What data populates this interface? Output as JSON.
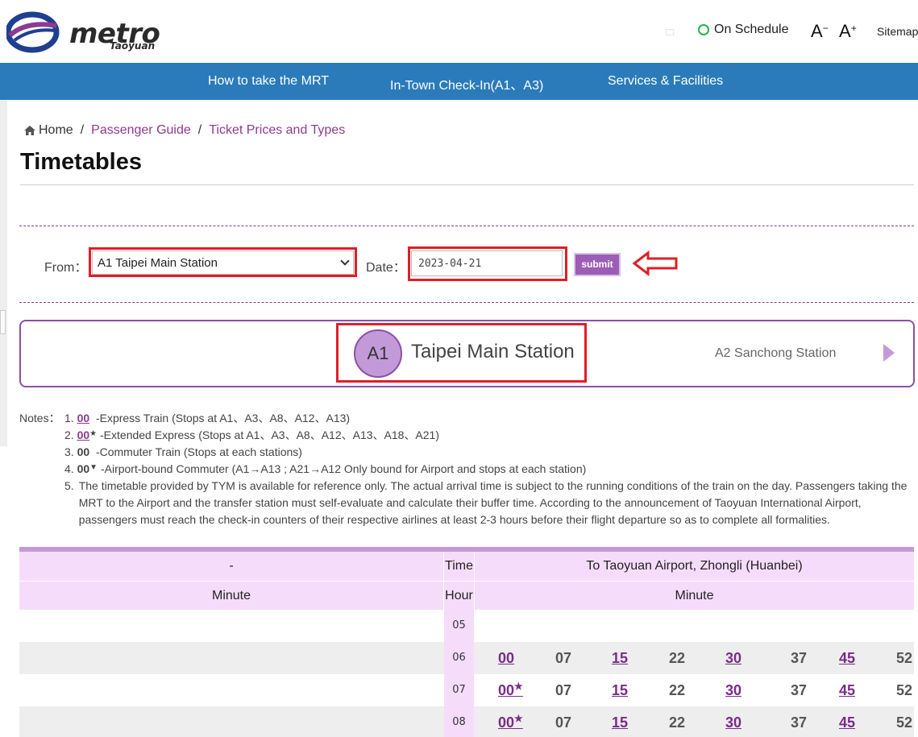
{
  "header": {
    "logo_text": "metro",
    "logo_sub": "Taoyuan",
    "status": "On Schedule",
    "font_decrease": "A",
    "font_decrease_sup": "−",
    "font_increase": "A",
    "font_increase_sup": "+",
    "sitemap": "Sitemap",
    "status_color": "#2ab04a"
  },
  "nav": {
    "items": [
      "How to take the MRT",
      "In-Town Check-In(A1、A3)",
      "Services & Facilities"
    ],
    "bg_color": "#2b7bba"
  },
  "breadcrumb": {
    "home": "Home",
    "sep": "/",
    "items": [
      "Passenger Guide",
      "Ticket Prices and Types"
    ]
  },
  "page_title": "Timetables",
  "form": {
    "from_label": "From：",
    "from_value": "A1 Taipei Main Station",
    "date_label": "Date：",
    "date_value": "2023-04-21",
    "submit_label": "submit"
  },
  "station": {
    "code": "A1",
    "name": "Taipei Main Station",
    "next": "A2 Sanchong Station"
  },
  "notes": {
    "label": "Notes：",
    "items": [
      {
        "num": "1.",
        "code": "00",
        "sup": "",
        "text": "-Express Train (Stops at A1、A3、A8、A12、A13)"
      },
      {
        "num": "2.",
        "code": "00",
        "sup": "★",
        "text": "-Extended Express (Stops at A1、A3、A8、A12、A13、A18、A21)"
      },
      {
        "num": "3.",
        "code": "00",
        "sup": "",
        "text": "-Commuter Train (Stops at each stations)"
      },
      {
        "num": "4.",
        "code": "00",
        "sup": "▼",
        "text": "-Airport-bound Commuter (A1→A13 ; A21→A12 Only bound for Airport and stops at each station)"
      },
      {
        "num": "5.",
        "code": "",
        "sup": "",
        "text": "The timetable provided by TYM is available for reference only. The actual arrival time is subject to the running conditions of the train on the day. Passengers taking the MRT to the Airport and the transfer station must self-evaluate and calculate their buffer time. According to the announcement of Taoyuan International Airport, passengers must reach the check-in counters of their respective airlines at least 2-3 hours before their flight departure so as to complete all formalities."
      }
    ]
  },
  "timetable": {
    "left_header": "-",
    "time_header": "Time",
    "right_header": "To Taoyuan Airport, Zhongli (Huanbei)",
    "left_sub": "Minute",
    "hour_sub": "Hour",
    "right_sub": "Minute",
    "rows": [
      {
        "hour": "05",
        "minutes": []
      },
      {
        "hour": "06",
        "minutes": [
          {
            "m": "00",
            "sup": "",
            "link": true
          },
          {
            "m": "07",
            "sup": "",
            "link": false
          },
          {
            "m": "15",
            "sup": "",
            "link": true
          },
          {
            "m": "22",
            "sup": "",
            "link": false
          },
          {
            "m": "30",
            "sup": "",
            "link": true
          },
          {
            "m": "37",
            "sup": "",
            "link": false
          },
          {
            "m": "45",
            "sup": "",
            "link": true
          },
          {
            "m": "52",
            "sup": "",
            "link": false
          }
        ]
      },
      {
        "hour": "07",
        "minutes": [
          {
            "m": "00",
            "sup": "★",
            "link": true
          },
          {
            "m": "07",
            "sup": "",
            "link": false
          },
          {
            "m": "15",
            "sup": "",
            "link": true
          },
          {
            "m": "22",
            "sup": "",
            "link": false
          },
          {
            "m": "30",
            "sup": "",
            "link": true
          },
          {
            "m": "37",
            "sup": "",
            "link": false
          },
          {
            "m": "45",
            "sup": "",
            "link": true
          },
          {
            "m": "52",
            "sup": "",
            "link": false
          }
        ]
      },
      {
        "hour": "08",
        "minutes": [
          {
            "m": "00",
            "sup": "★",
            "link": true
          },
          {
            "m": "07",
            "sup": "",
            "link": false
          },
          {
            "m": "15",
            "sup": "",
            "link": true
          },
          {
            "m": "22",
            "sup": "",
            "link": false
          },
          {
            "m": "30",
            "sup": "",
            "link": true
          },
          {
            "m": "37",
            "sup": "",
            "link": false
          },
          {
            "m": "45",
            "sup": "",
            "link": true
          },
          {
            "m": "52",
            "sup": "",
            "link": false
          }
        ]
      }
    ]
  },
  "colors": {
    "accent_purple": "#8c3a8f",
    "highlight_red": "#e01e25",
    "header_pink": "#f6dcfb"
  }
}
